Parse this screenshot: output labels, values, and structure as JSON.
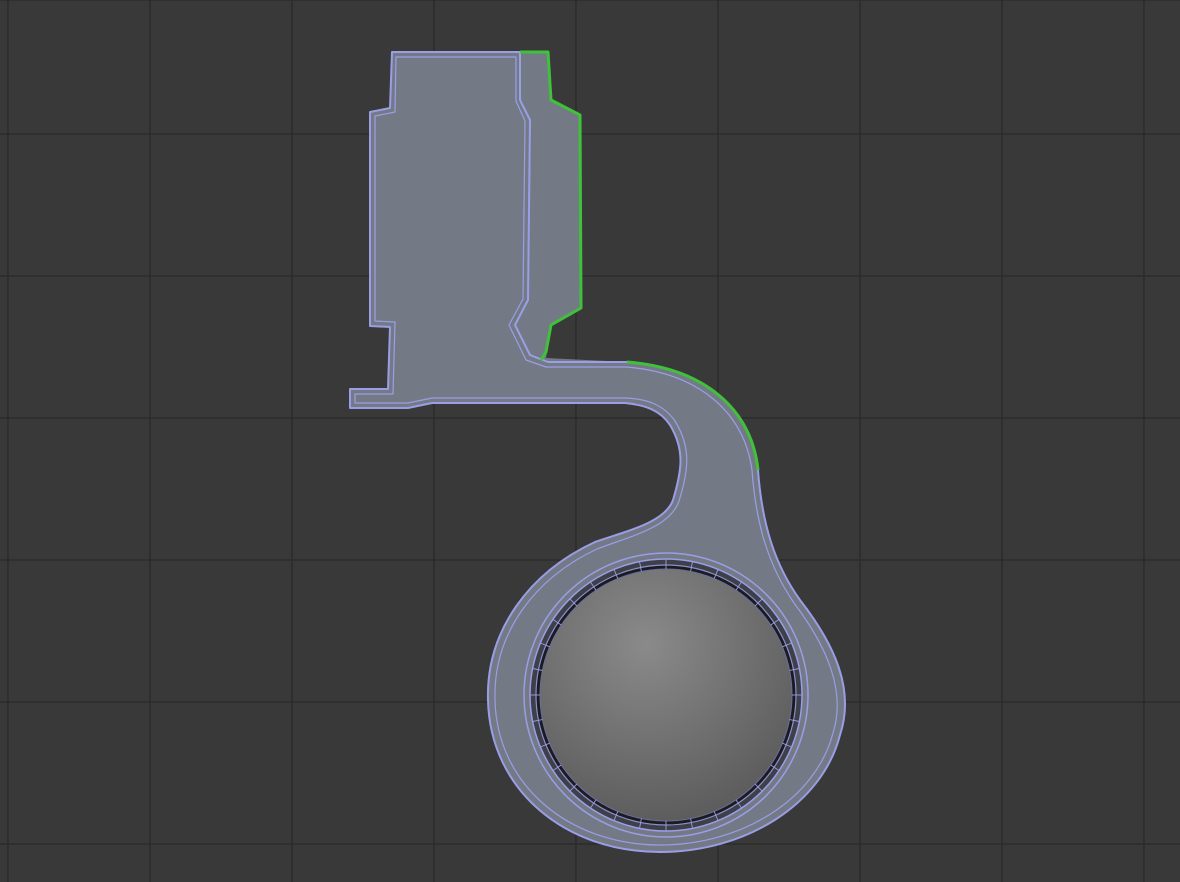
{
  "viewport": {
    "background_color": "#393939",
    "grid_color": "#2a2a2a",
    "grid_visible": true
  },
  "mesh": {
    "fill_color": "#737a86",
    "edge_color": "#9a9ee6",
    "selected_edge_color": "#3fc23a",
    "inner_edge_color": "#1b1b22",
    "hole_gradient": [
      "#8a8a8a",
      "#5a5a5a"
    ]
  }
}
